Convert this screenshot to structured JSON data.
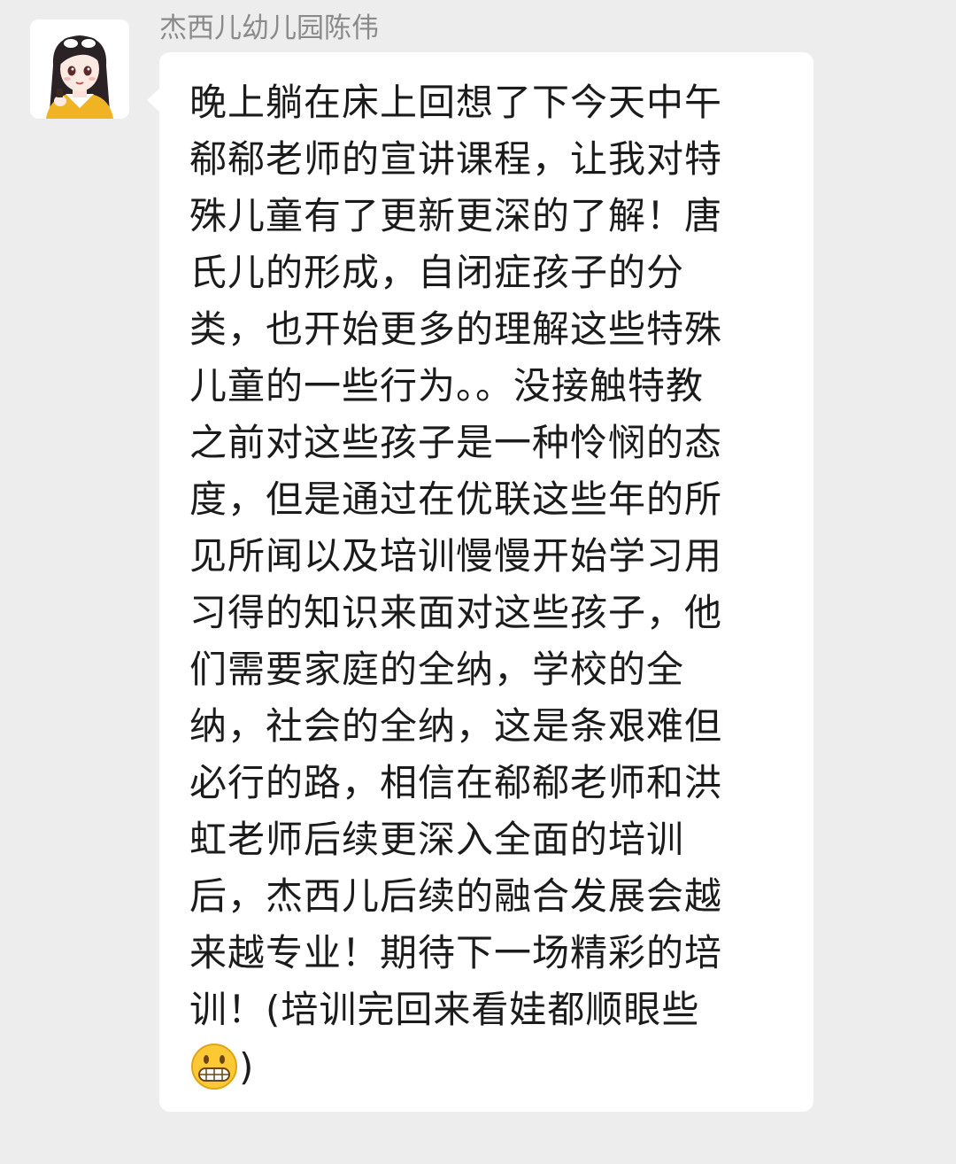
{
  "chat": {
    "sender_name": "杰西儿幼儿园陈伟",
    "avatar_icon": "girl-avatar-icon",
    "bubble_color": "#ffffff",
    "background_color": "#ededed",
    "message": {
      "text": "晚上躺在床上回想了下今天中午\n郗郗老师的宣讲课程，让我对特\n殊儿童有了更新更深的了解！唐\n氏儿的形成，自闭症孩子的分\n类，也开始更多的理解这些特殊\n儿童的一些行为。。没接触特教\n之前对这些孩子是一种怜悯的态\n度，但是通过在优联这些年的所\n见所闻以及培训慢慢开始学习用\n习得的知识来面对这些孩子，他\n们需要家庭的全纳，学校的全\n纳，社会的全纳，这是条艰难但\n必行的路，相信在郗郗老师和洪\n虹老师后续更深入全面的培训\n后，杰西儿后续的融合发展会越\n来越专业！期待下一场精彩的培\n训！(培训完回来看娃都顺眼些",
      "emoji": "grinning-face-icon",
      "closing": ")"
    }
  }
}
